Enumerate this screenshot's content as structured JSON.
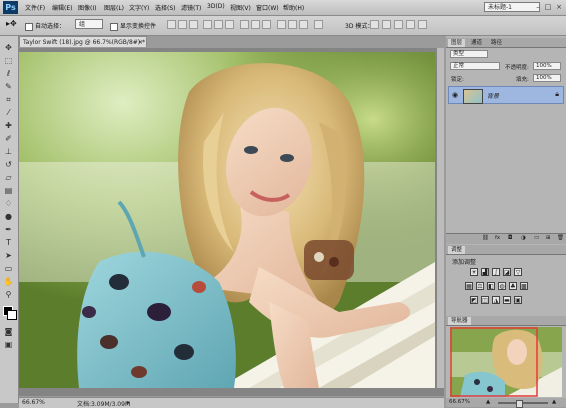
{
  "app": {
    "logo": "Ps",
    "menus": [
      "文件(F)",
      "编辑(E)",
      "图像(I)",
      "图层(L)",
      "文字(Y)",
      "选择(S)",
      "滤镜(T)",
      "3D(D)",
      "视图(V)",
      "窗口(W)",
      "帮助(H)"
    ],
    "workspace": "未标题-1"
  },
  "options": {
    "auto_select": "自动选择：",
    "auto_select_value": "组",
    "show_transform": "显示变换控件",
    "mode3d": "3D 模式："
  },
  "document": {
    "tab_title": "Taylor Swift (18).jpg @ 66.7%(RGB/8#) *",
    "zoom": "66.67%",
    "doc_size": "文档:3.09M/3.09M"
  },
  "layers_panel": {
    "tabs": [
      "图层",
      "通道",
      "路径"
    ],
    "kind": "类型",
    "blend_mode": "正常",
    "opacity_label": "不透明度:",
    "opacity_value": "100%",
    "lock_label": "锁定:",
    "fill_label": "填充:",
    "fill_value": "100%",
    "layer_name": "背景"
  },
  "adjustments_panel": {
    "tab": "调整",
    "title": "添加调整"
  },
  "navigator_panel": {
    "tab": "导航器",
    "zoom": "66.67%"
  },
  "colors": {
    "accent": "#0e3a66",
    "layer_highlight": "#9db7e0",
    "nav_frame": "#e23b3b"
  }
}
